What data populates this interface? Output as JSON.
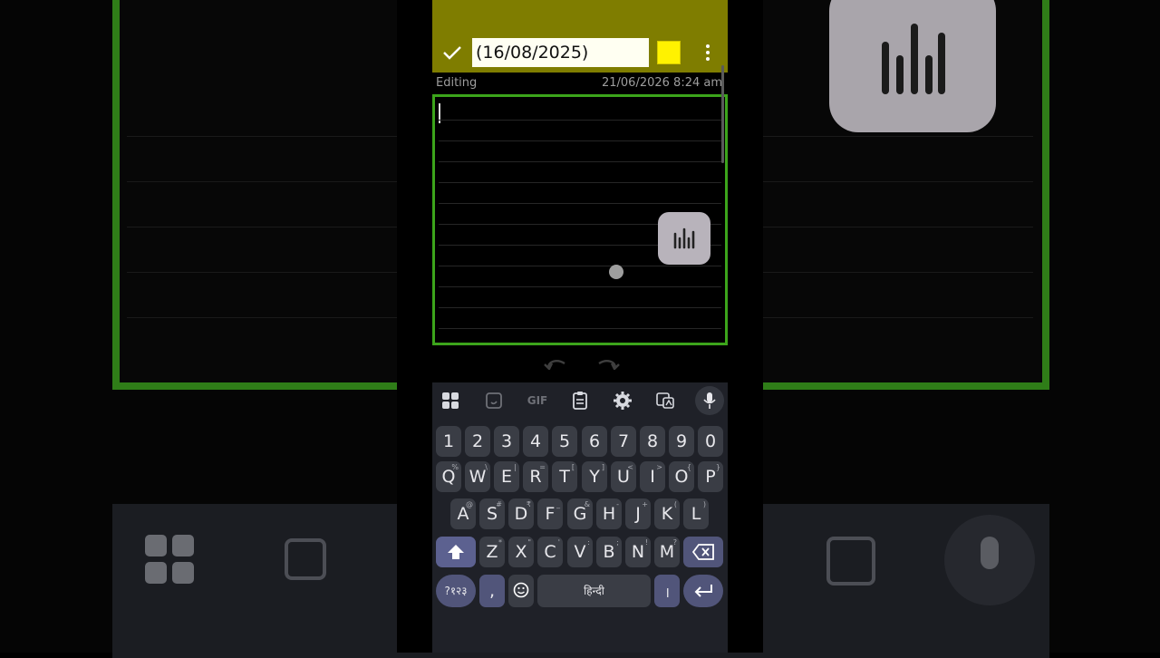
{
  "note": {
    "title_value": "(16/08/2025)",
    "color": "#fff200",
    "mode": "Editing",
    "timestamp": "21/06/2026 8:24 am"
  },
  "icons": {
    "confirm": "check-icon",
    "overflow": "more-vert-icon",
    "voice": "sound-bars-icon",
    "undo": "undo-icon",
    "redo": "redo-icon"
  },
  "keyboard": {
    "toolbar": [
      "apps-grid-icon",
      "sticker-icon",
      "GIF",
      "clipboard-icon",
      "settings-icon",
      "translate-icon",
      "mic-icon"
    ],
    "gif_label": "GIF",
    "numbers": [
      "1",
      "2",
      "3",
      "4",
      "5",
      "6",
      "7",
      "8",
      "9",
      "0"
    ],
    "row1": [
      {
        "k": "Q",
        "s": "%"
      },
      {
        "k": "W",
        "s": "\\"
      },
      {
        "k": "E",
        "s": "|"
      },
      {
        "k": "R",
        "s": "="
      },
      {
        "k": "T",
        "s": "["
      },
      {
        "k": "Y",
        "s": "]"
      },
      {
        "k": "U",
        "s": "<"
      },
      {
        "k": "I",
        "s": ">"
      },
      {
        "k": "O",
        "s": "{"
      },
      {
        "k": "P",
        "s": "}"
      }
    ],
    "row2": [
      {
        "k": "A",
        "s": "@"
      },
      {
        "k": "S",
        "s": "#"
      },
      {
        "k": "D",
        "s": "₹"
      },
      {
        "k": "F",
        "s": "_"
      },
      {
        "k": "G",
        "s": "&"
      },
      {
        "k": "H",
        "s": "-"
      },
      {
        "k": "J",
        "s": "+"
      },
      {
        "k": "K",
        "s": "("
      },
      {
        "k": "L",
        "s": ")"
      }
    ],
    "row3": [
      {
        "k": "Z",
        "s": "*"
      },
      {
        "k": "X",
        "s": "\""
      },
      {
        "k": "C",
        "s": "'"
      },
      {
        "k": "V",
        "s": ":"
      },
      {
        "k": "B",
        "s": ";"
      },
      {
        "k": "N",
        "s": "!"
      },
      {
        "k": "M",
        "s": "?"
      }
    ],
    "symbols_label": "?१२३",
    "comma": ",",
    "space_label": "हिन्दी",
    "danda": "।",
    "colors": {
      "bg": "#1f2128",
      "key": "#3a3d45",
      "accent": "#5c6190"
    }
  },
  "colors": {
    "toolbar": "#7f7d00",
    "editor_border": "#3ca41b"
  }
}
